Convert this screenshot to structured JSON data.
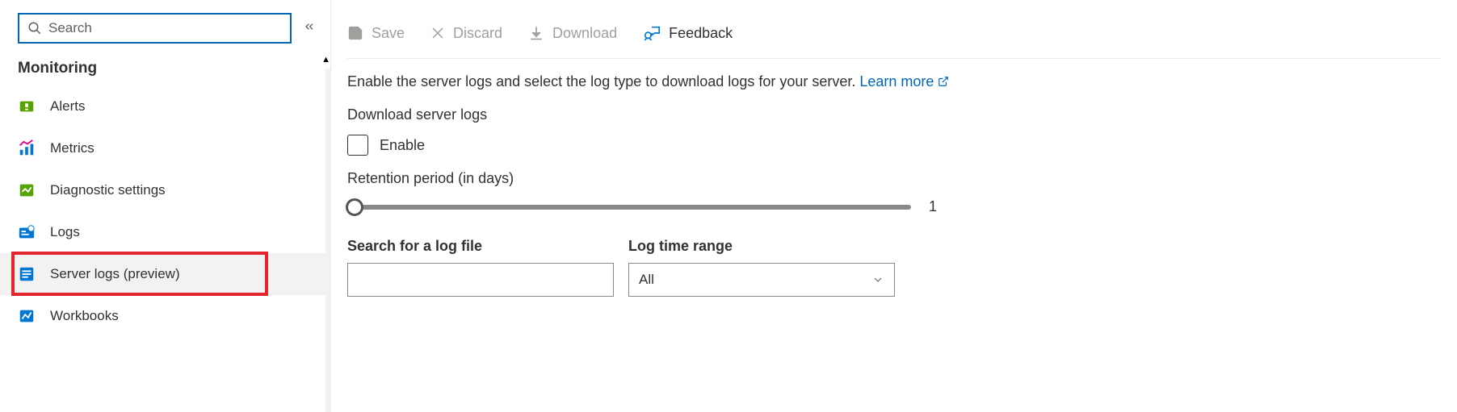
{
  "sidebar": {
    "search_placeholder": "Search",
    "section_title": "Monitoring",
    "items": [
      {
        "label": "Alerts"
      },
      {
        "label": "Metrics"
      },
      {
        "label": "Diagnostic settings"
      },
      {
        "label": "Logs"
      },
      {
        "label": "Server logs (preview)"
      },
      {
        "label": "Workbooks"
      }
    ]
  },
  "toolbar": {
    "save": "Save",
    "discard": "Discard",
    "download": "Download",
    "feedback": "Feedback"
  },
  "description": {
    "text": "Enable the server logs and select the log type to download logs for your server.",
    "link": "Learn more"
  },
  "download_section_label": "Download server logs",
  "enable_label": "Enable",
  "retention_label": "Retention period (in days)",
  "retention_value": "1",
  "search_label": "Search for a log file",
  "time_range_label": "Log time range",
  "time_range_value": "All"
}
